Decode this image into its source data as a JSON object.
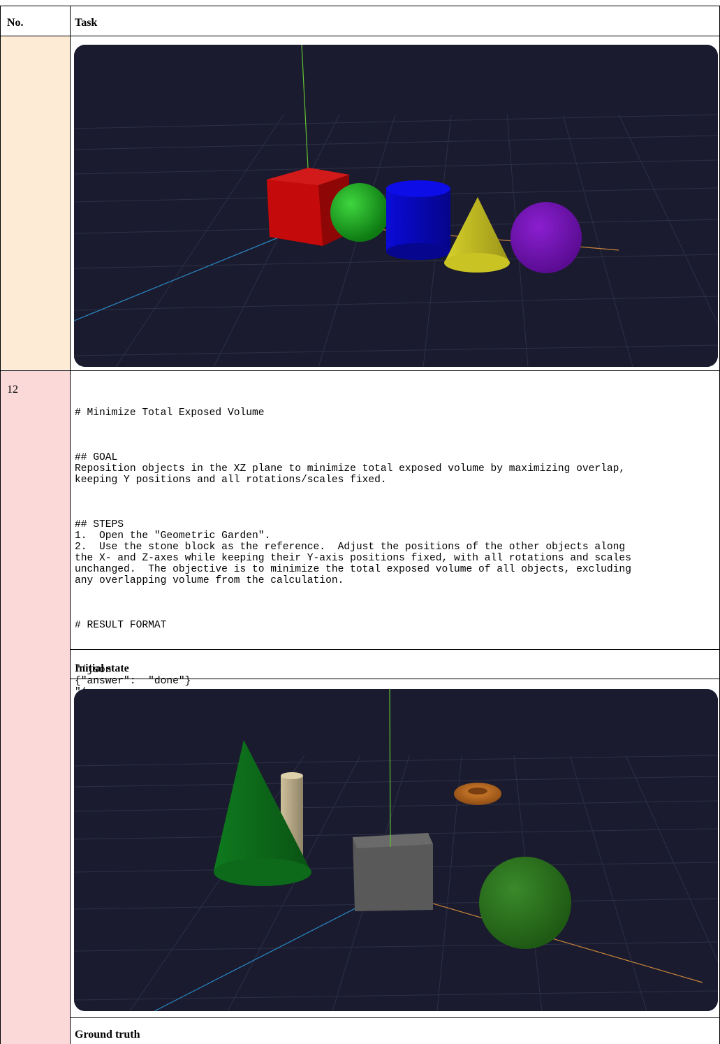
{
  "table": {
    "col_no_header": "No.",
    "col_task_header": "Task",
    "row_number": "12",
    "task_text": {
      "title": "# Minimize Total Exposed Volume",
      "goal_heading": "## GOAL",
      "goal_body": "Reposition objects in the XZ plane to minimize total exposed volume by maximizing overlap,\nkeeping Y positions and all rotations/scales fixed.",
      "steps_heading": "## STEPS",
      "step1": "1.  Open the \"Geometric Garden\".",
      "step2": "2.  Use the stone block as the reference.  Adjust the positions of the other objects along\nthe X- and Z-axes while keeping their Y-axis positions fixed, with all rotations and scales\nunchanged.  The objective is to minimize the total exposed volume of all objects, excluding\nany overlapping volume from the calculation.",
      "result_heading": "# RESULT FORMAT",
      "code_open": "\"‘json",
      "code_body": "{\"answer\":  \"done\"}",
      "code_close": "\"‘"
    },
    "initial_state_label": "Initial state",
    "ground_truth_label": "Ground truth"
  },
  "colors": {
    "row_prev_bg": "#fdebd6",
    "row_current_bg": "#fcd9d9",
    "viewport_bg": "#1a1b2e"
  }
}
